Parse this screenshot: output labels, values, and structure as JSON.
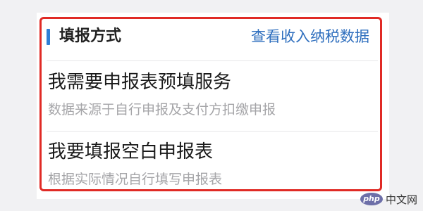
{
  "section": {
    "title": "填报方式",
    "link_label": "查看收入纳税数据"
  },
  "options": [
    {
      "title": "我需要申报表预填服务",
      "description": "数据来源于自行申报及支付方扣缴申报"
    },
    {
      "title": "我要填报空白申报表",
      "description": "根据实际情况自行填写申报表"
    }
  ],
  "watermark": {
    "logo_text": "php",
    "site_text": "中文网"
  },
  "colors": {
    "accent_bar": "#2f7fd6",
    "link": "#2f6fbe",
    "highlight_border": "#e02a25",
    "description_text": "#a5a5a8"
  }
}
